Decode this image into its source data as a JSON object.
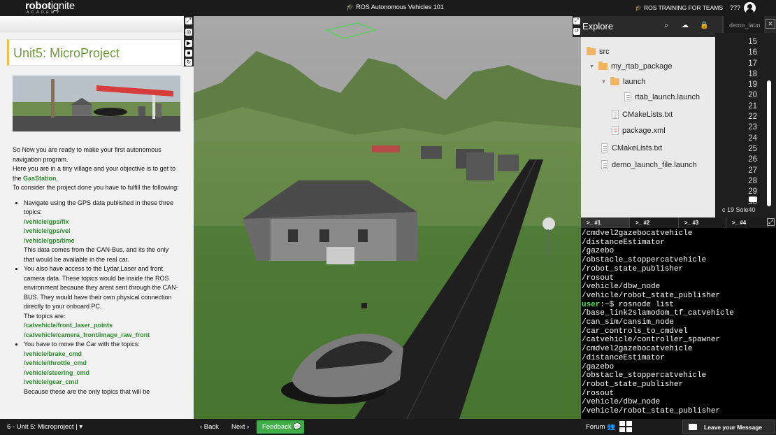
{
  "topbar": {
    "logo_main": "robot",
    "logo_light": "ignite",
    "logo_sub": "ACADEMY",
    "course_title": "ROS Autonomous Vehicles 101",
    "teams_label": "ROS TRAINING FOR TEAMS",
    "user_label": "???"
  },
  "notebook": {
    "unit_title": "Unit5: MicroProject",
    "intro_1": "So Now you are ready to make your first autonomous navigation program.",
    "intro_2_pre": "Here you are in a tiny village and your objective is to get to the ",
    "intro_2_link": "GasStation",
    "intro_2_post": ".",
    "intro_3": "To consider the project done you have to fulfill the following:",
    "items": [
      {
        "text": "Navigate using the GPS data published in these three topics:",
        "topics": [
          "/vehicle/gps/fix",
          "/vehicle/gps/vel",
          "/vehicle/gps/time"
        ],
        "after": "This data comes from the CAN-Bus, and its the only that would be available in the real car."
      },
      {
        "text": "You also have access to the Lydar,Laser and front camera data. These topics would be inside the ROS environment because they arent sent through the CAN-BUS. They would have their own physical connection directly to your onboard PC.",
        "after": "The topics are:",
        "topics": [
          "/catvehicle/front_laser_points",
          "/catvehicle/camera_front/image_raw_front"
        ]
      },
      {
        "text": "You have to move the Car with the topics:",
        "topics": [
          "/vehicle/brake_cmd",
          "/vehicle/throttle_cmd",
          "/vehicle/steering_cmd",
          "/vehicle/gear_cmd"
        ],
        "after": "Because these are the only topics that will be"
      }
    ]
  },
  "explorer": {
    "title": "Explore",
    "tree": [
      {
        "label": "src",
        "type": "folder"
      },
      {
        "label": "my_rtab_package",
        "type": "folder"
      },
      {
        "label": "launch",
        "type": "folder"
      },
      {
        "label": "rtab_launch.launch",
        "type": "file"
      },
      {
        "label": "CMakeLists.txt",
        "type": "file"
      },
      {
        "label": "package.xml",
        "type": "xml"
      },
      {
        "label": "CMakeLists.txt",
        "type": "file"
      },
      {
        "label": "demo_launch_file.launch",
        "type": "file"
      }
    ]
  },
  "editor": {
    "tab_label": "demo_laun",
    "line_numbers": [
      "15",
      "16",
      "17",
      "18",
      "19",
      "20",
      "21",
      "22",
      "23",
      "24",
      "25",
      "26",
      "27",
      "28",
      "29",
      "30"
    ],
    "status": "c 19 Sole40"
  },
  "terminal": {
    "tabs": [
      ">_ #1",
      ">_ #2",
      ">_ #3",
      ">_ #4"
    ],
    "lines": [
      "/cmdvel2gazebocatvehicle",
      "/distanceEstimator",
      "/gazebo",
      "/obstacle_stoppercatvehicle",
      "/robot_state_publisher",
      "/rosout",
      "/vehicle/dbw_node",
      "/vehicle/robot_state_publisher"
    ],
    "prompt_user": "user",
    "prompt_rest": ":~$ rosnode list",
    "lines_after": [
      "/base_link2slamodom_tf_catvehicle",
      "/can_sim/cansim_node",
      "/car_controls_to_cmdvel",
      "/catvehicle/controller_spawner",
      "/cmdvel2gazebocatvehicle",
      "/distanceEstimator",
      "/gazebo",
      "/obstacle_stoppercatvehicle",
      "/robot_state_publisher",
      "/rosout",
      "/vehicle/dbw_node",
      "/vehicle/robot_state_publisher"
    ]
  },
  "bottombar": {
    "unit_select": "6 - Unit 5: Microproject |",
    "back": "‹ Back",
    "next": "Next ›",
    "feedback": "Feedback",
    "forum": "Forum",
    "message": "Leave your Message"
  },
  "colors": {
    "accent_green": "#3fae49",
    "topic_green": "#2e8b2e",
    "unit_title": "#6f9a3d"
  }
}
